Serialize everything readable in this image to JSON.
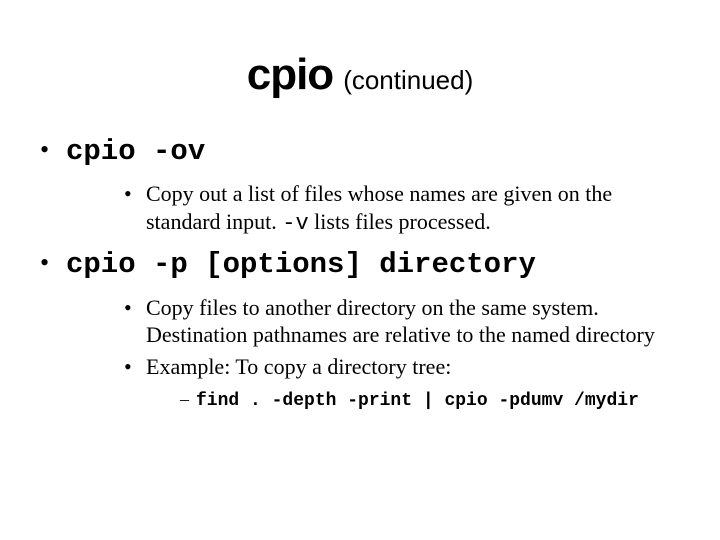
{
  "title": {
    "main": "cpio",
    "suffix": "(continued)"
  },
  "items": [
    {
      "cmd": "cpio -ov",
      "sub": [
        {
          "text_before": "Copy out a list of files whose names are given on the standard input.  ",
          "code": "-v",
          "text_after": " lists files processed."
        }
      ]
    },
    {
      "cmd": "cpio -p [options] directory",
      "sub": [
        {
          "text_before": "Copy files to another directory on the same system. Destination pathnames are relative to the named directory",
          "code": "",
          "text_after": ""
        },
        {
          "text_before": "Example: To copy a directory tree:",
          "code": "",
          "text_after": "",
          "sub": [
            {
              "code": "find . -depth -print | cpio -pdumv /mydir"
            }
          ]
        }
      ]
    }
  ]
}
